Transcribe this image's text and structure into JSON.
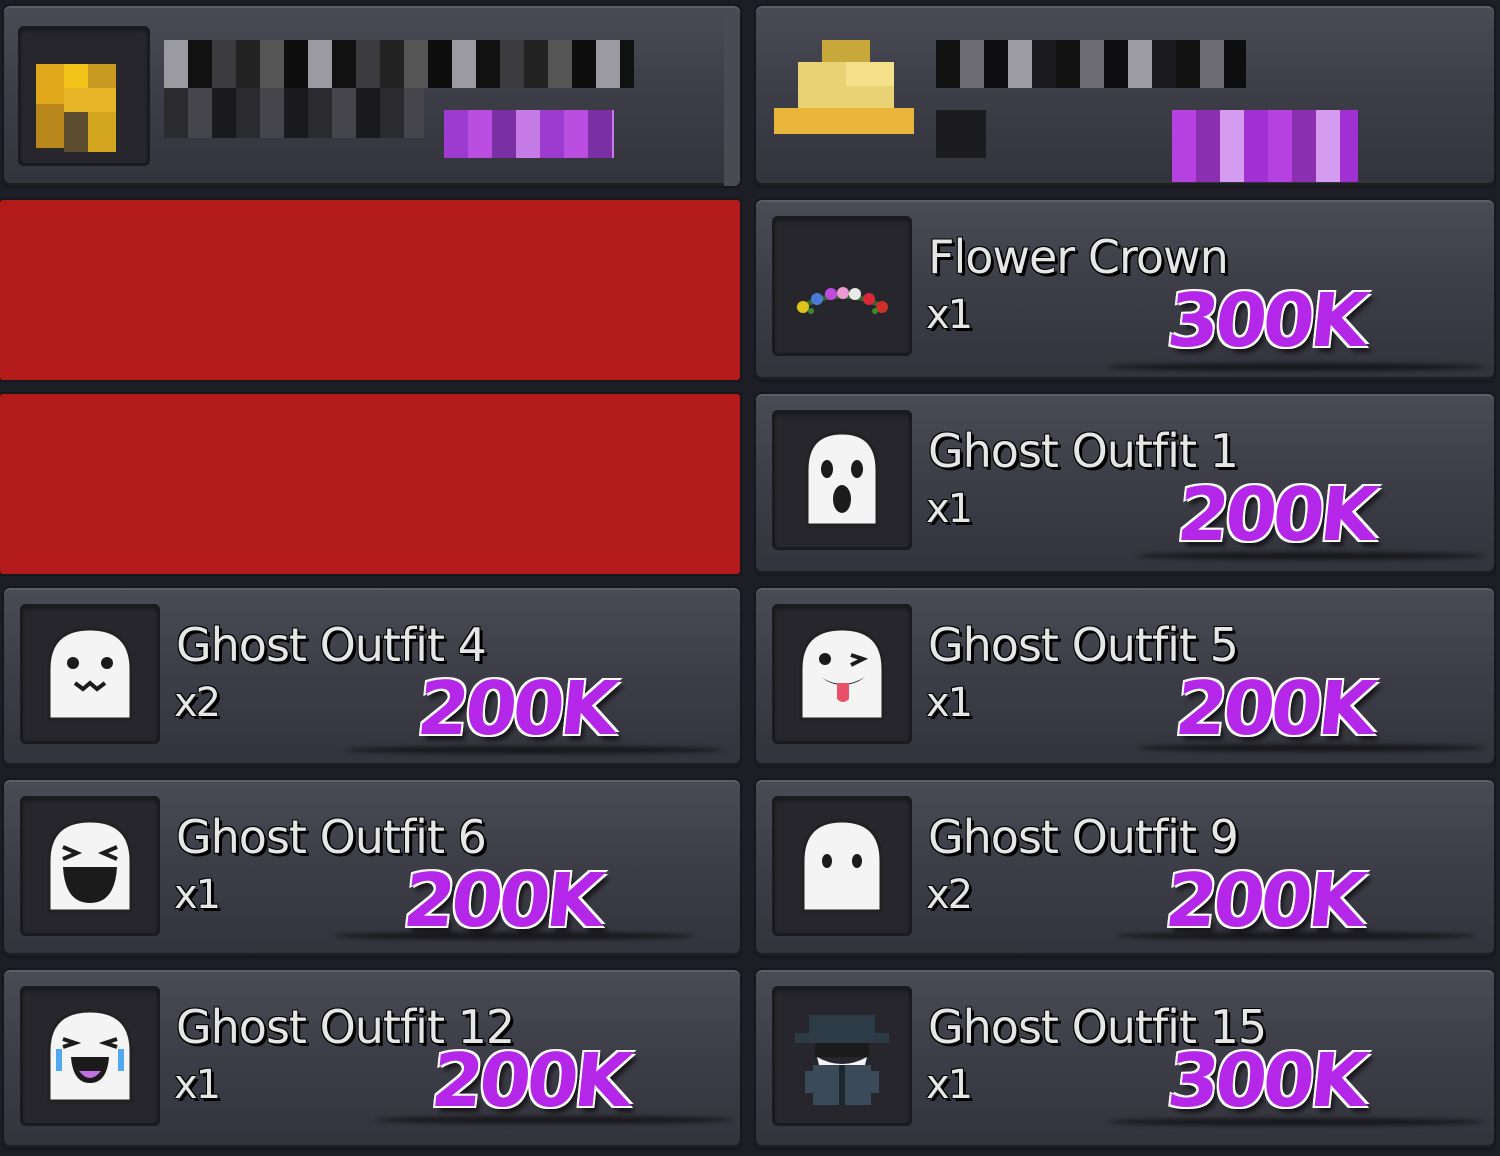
{
  "header": {
    "left_panel": "pixelated-player-left",
    "right_panel": "pixelated-player-right"
  },
  "items": [
    {
      "name": "Flower Crown",
      "qty": "x1",
      "price": "300K",
      "icon": "flower-crown-icon"
    },
    {
      "name": "Ghost Outfit 1",
      "qty": "x1",
      "price": "200K",
      "icon": "ghost-outfit-1-icon"
    },
    {
      "name": "Ghost Outfit 4",
      "qty": "x2",
      "price": "200K",
      "icon": "ghost-outfit-4-icon"
    },
    {
      "name": "Ghost Outfit 5",
      "qty": "x1",
      "price": "200K",
      "icon": "ghost-outfit-5-icon"
    },
    {
      "name": "Ghost Outfit 6",
      "qty": "x1",
      "price": "200K",
      "icon": "ghost-outfit-6-icon"
    },
    {
      "name": "Ghost Outfit 9",
      "qty": "x2",
      "price": "200K",
      "icon": "ghost-outfit-9-icon"
    },
    {
      "name": "Ghost Outfit 12",
      "qty": "x1",
      "price": "200K",
      "icon": "ghost-outfit-12-icon"
    },
    {
      "name": "Ghost Outfit 15",
      "qty": "x1",
      "price": "300K",
      "icon": "ghost-outfit-15-icon"
    }
  ],
  "colors": {
    "price": "#b527e8",
    "redaction": "#b31b1b",
    "panel": "#3e3e48",
    "background": "#1d1d25"
  }
}
